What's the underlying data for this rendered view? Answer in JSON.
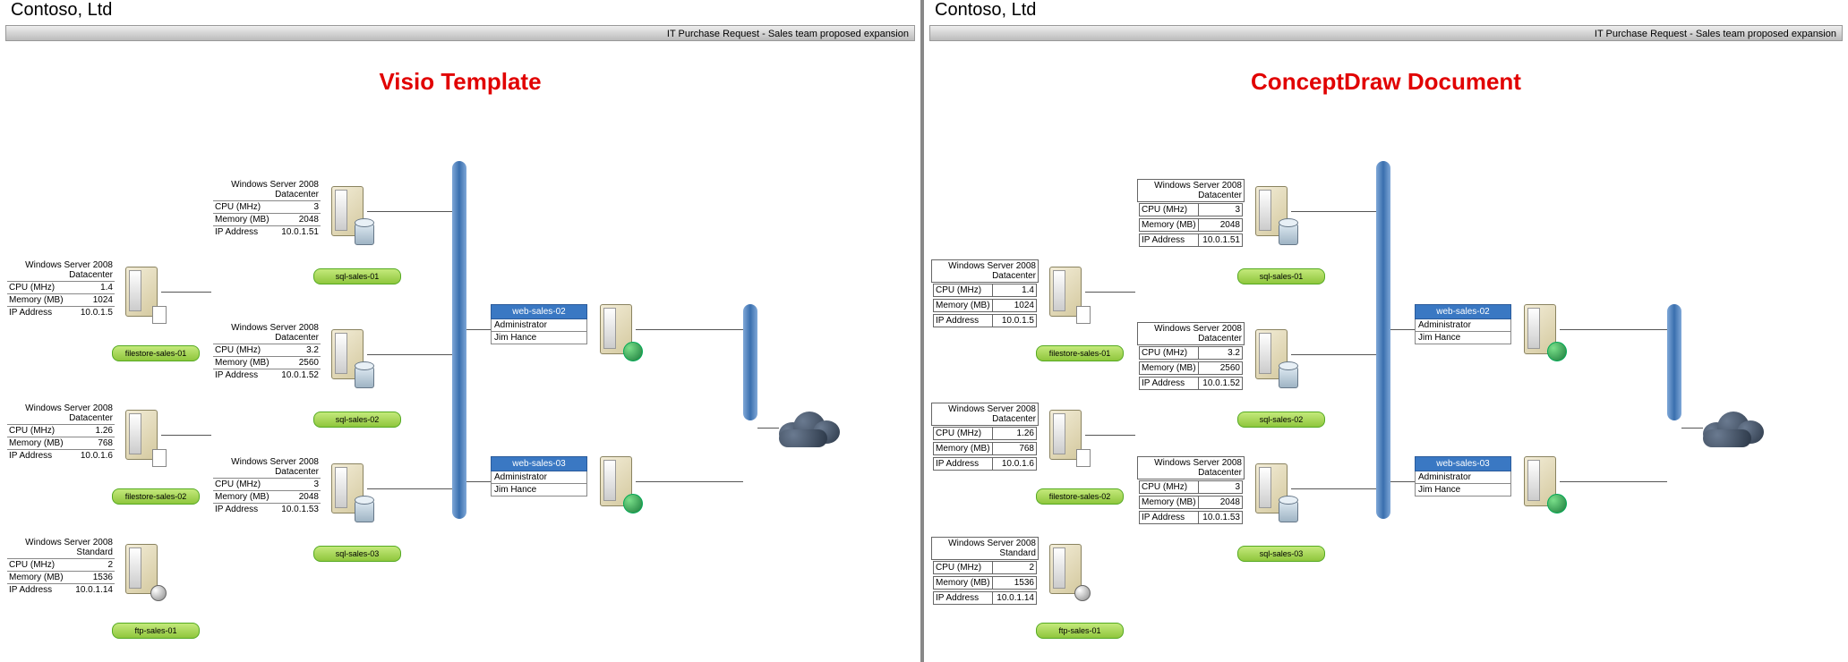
{
  "company": "Contoso, Ltd",
  "subtitle": "IT Purchase Request - Sales team proposed expansion",
  "left_title": "Visio Template",
  "right_title": "ConceptDraw Document",
  "servers": {
    "file1": {
      "os": "Windows Server 2008",
      "edition": "Datacenter",
      "rows": [
        [
          "CPU (MHz)",
          "1.4"
        ],
        [
          "Memory (MB)",
          "1024"
        ],
        [
          "IP Address",
          "10.0.1.5"
        ]
      ],
      "label": "filestore-sales-01"
    },
    "file2": {
      "os": "Windows Server 2008",
      "edition": "Datacenter",
      "rows": [
        [
          "CPU (MHz)",
          "1.26"
        ],
        [
          "Memory (MB)",
          "768"
        ],
        [
          "IP Address",
          "10.0.1.6"
        ]
      ],
      "label": "filestore-sales-02"
    },
    "ftp1": {
      "os": "Windows Server 2008",
      "edition": "Standard",
      "rows": [
        [
          "CPU (MHz)",
          "2"
        ],
        [
          "Memory (MB)",
          "1536"
        ],
        [
          "IP Address",
          "10.0.1.14"
        ]
      ],
      "label": "ftp-sales-01"
    },
    "sql1": {
      "os": "Windows Server 2008",
      "edition": "Datacenter",
      "rows": [
        [
          "CPU (MHz)",
          "3"
        ],
        [
          "Memory (MB)",
          "2048"
        ],
        [
          "IP Address",
          "10.0.1.51"
        ]
      ],
      "label": "sql-sales-01"
    },
    "sql2": {
      "os": "Windows Server 2008",
      "edition": "Datacenter",
      "rows": [
        [
          "CPU (MHz)",
          "3.2"
        ],
        [
          "Memory (MB)",
          "2560"
        ],
        [
          "IP Address",
          "10.0.1.52"
        ]
      ],
      "label": "sql-sales-02"
    },
    "sql3": {
      "os": "Windows Server 2008",
      "edition": "Datacenter",
      "rows": [
        [
          "CPU (MHz)",
          "3"
        ],
        [
          "Memory (MB)",
          "2048"
        ],
        [
          "IP Address",
          "10.0.1.53"
        ]
      ],
      "label": "sql-sales-03"
    },
    "web2": {
      "name": "web-sales-02",
      "admin_k": "Administrator",
      "admin_v": "Jim Hance"
    },
    "web3": {
      "name": "web-sales-03",
      "admin_k": "Administrator",
      "admin_v": "Jim Hance"
    }
  }
}
